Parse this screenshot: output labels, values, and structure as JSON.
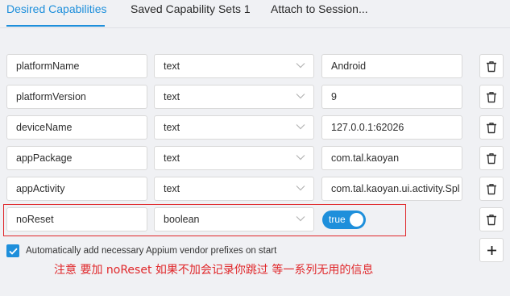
{
  "tabs": [
    {
      "label": "Desired Capabilities",
      "active": true
    },
    {
      "label": "Saved Capability Sets 1",
      "active": false
    },
    {
      "label": "Attach to Session...",
      "active": false
    }
  ],
  "capabilities": [
    {
      "name": "platformName",
      "type": "text",
      "value": "Android"
    },
    {
      "name": "platformVersion",
      "type": "text",
      "value": "9"
    },
    {
      "name": "deviceName",
      "type": "text",
      "value": "127.0.0.1:62026"
    },
    {
      "name": "appPackage",
      "type": "text",
      "value": "com.tal.kaoyan"
    },
    {
      "name": "appActivity",
      "type": "text",
      "value": "com.tal.kaoyan.ui.activity.Spl"
    },
    {
      "name": "noReset",
      "type": "boolean",
      "value": "true"
    }
  ],
  "auto_prefix": {
    "checked": true,
    "label": "Automatically add necessary Appium vendor prefixes on start"
  },
  "annotation": "注意 要加 noReset 如果不加会记录你跳过 等一系列无用的信息",
  "icons": {
    "delete": "trash-icon",
    "dropdown": "chevron-down-icon",
    "add": "plus-icon",
    "check": "check-icon"
  },
  "colors": {
    "accent": "#1e8fdb",
    "highlight": "#e0272a"
  }
}
